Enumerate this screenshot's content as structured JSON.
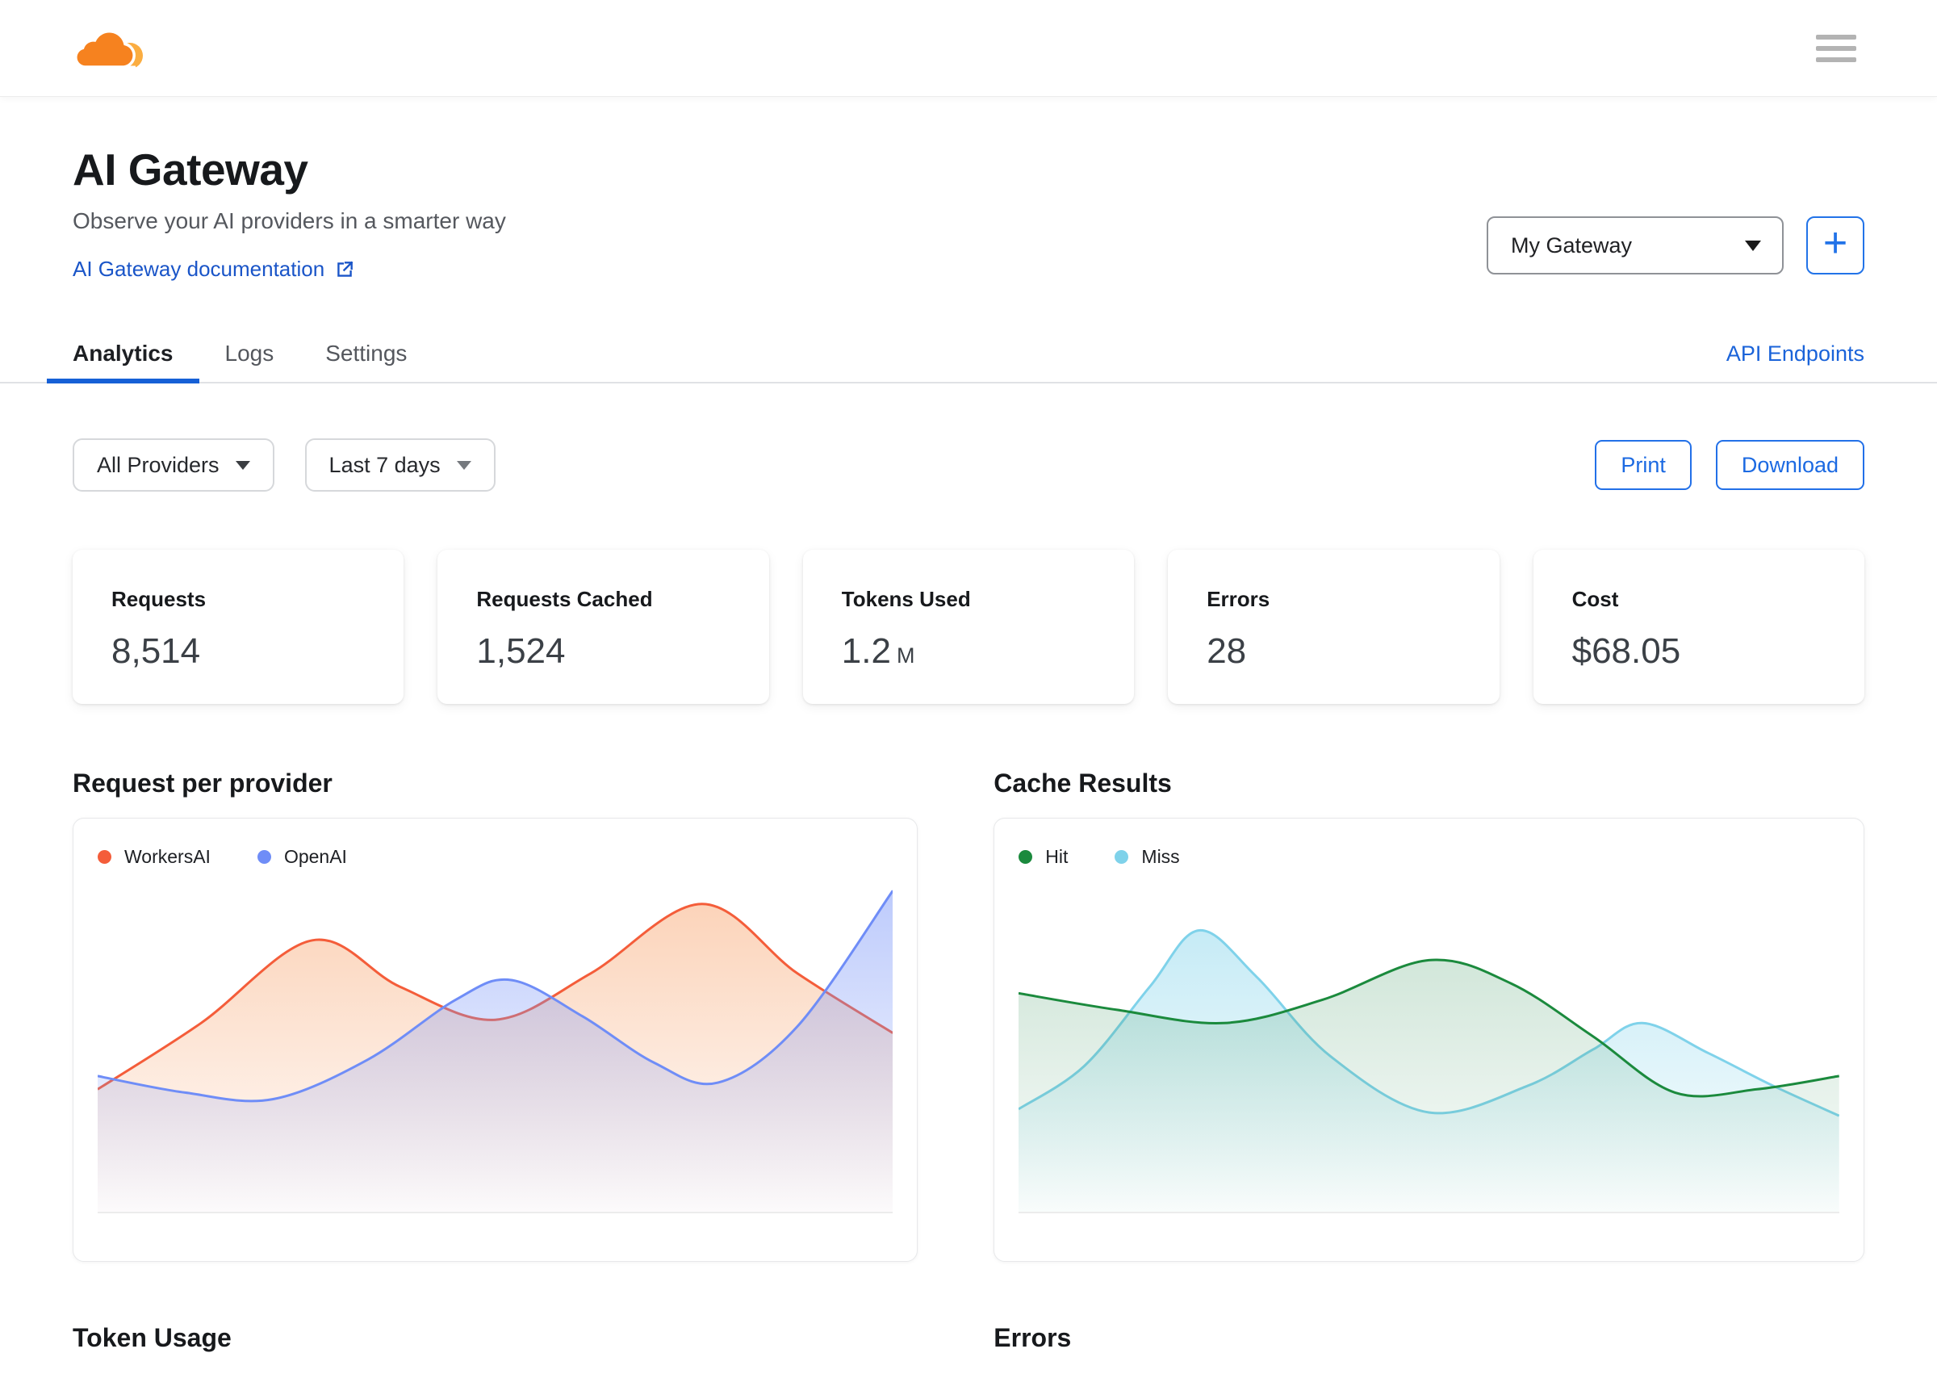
{
  "page": {
    "title": "AI Gateway",
    "subtitle": "Observe your AI providers in a smarter way",
    "doc_link": "AI Gateway documentation"
  },
  "gateway": {
    "selected": "My Gateway"
  },
  "icons": {
    "plus": "+"
  },
  "tabs": {
    "items": [
      "Analytics",
      "Logs",
      "Settings"
    ],
    "active": "Analytics",
    "api_link": "API Endpoints"
  },
  "filters": {
    "providers": "All Providers",
    "range": "Last 7 days"
  },
  "actions": {
    "print": "Print",
    "download": "Download"
  },
  "stats": [
    {
      "label": "Requests",
      "value": "8,514",
      "suffix": ""
    },
    {
      "label": "Requests Cached",
      "value": "1,524",
      "suffix": ""
    },
    {
      "label": "Tokens Used",
      "value": "1.2",
      "suffix": "M"
    },
    {
      "label": "Errors",
      "value": "28",
      "suffix": ""
    },
    {
      "label": "Cost",
      "value": "$68.05",
      "suffix": ""
    }
  ],
  "sections": {
    "chart1_title": "Request per provider",
    "chart2_title": "Cache Results",
    "bottom1_title": "Token Usage",
    "bottom2_title": "Errors"
  },
  "colors": {
    "brand_orange": "#F6821F",
    "brand_orange_light": "#FBAD41",
    "link_blue": "#1a55c8",
    "action_blue": "#1c6ae2",
    "tab_underline": "#1660d6"
  },
  "chart_data": [
    {
      "type": "area",
      "title": "Request per provider",
      "xlabel": "",
      "ylabel": "",
      "axes_visible": false,
      "legend_position": "top-left",
      "ylim": [
        0,
        100
      ],
      "x_range": [
        0,
        100
      ],
      "series": [
        {
          "name": "WorkersAI",
          "color": "#f45d3a",
          "fill": "#f6904e",
          "fill_opacity_top": 0.42,
          "z": 0,
          "points": [
            [
              0,
              37
            ],
            [
              13,
              57
            ],
            [
              27,
              82
            ],
            [
              38,
              68
            ],
            [
              50,
              58
            ],
            [
              62,
              72
            ],
            [
              76,
              93
            ],
            [
              88,
              72
            ],
            [
              100,
              54
            ]
          ]
        },
        {
          "name": "OpenAI",
          "color": "#6f8df7",
          "fill": "#7894f8",
          "fill_opacity_top": 0.5,
          "z": 1,
          "points": [
            [
              0,
              41
            ],
            [
              11,
              36
            ],
            [
              22,
              34
            ],
            [
              34,
              46
            ],
            [
              45,
              64
            ],
            [
              52,
              70
            ],
            [
              61,
              59
            ],
            [
              70,
              45
            ],
            [
              78,
              39
            ],
            [
              88,
              56
            ],
            [
              100,
              97
            ]
          ]
        }
      ]
    },
    {
      "type": "area",
      "title": "Cache Results",
      "xlabel": "",
      "ylabel": "",
      "axes_visible": false,
      "legend_position": "top-left",
      "ylim": [
        0,
        100
      ],
      "x_range": [
        0,
        100
      ],
      "series": [
        {
          "name": "Hit",
          "color": "#1b8a3d",
          "fill": "#3c965f",
          "fill_opacity_top": 0.3,
          "z": 1,
          "points": [
            [
              0,
              66
            ],
            [
              12,
              61
            ],
            [
              25,
              57
            ],
            [
              37,
              64
            ],
            [
              50,
              76
            ],
            [
              60,
              69
            ],
            [
              70,
              53
            ],
            [
              80,
              36
            ],
            [
              90,
              37
            ],
            [
              100,
              41
            ]
          ]
        },
        {
          "name": "Miss",
          "color": "#7fd2ea",
          "fill": "#7fd2ea",
          "fill_opacity_top": 0.52,
          "z": 0,
          "points": [
            [
              0,
              31
            ],
            [
              8,
              44
            ],
            [
              16,
              68
            ],
            [
              22,
              85
            ],
            [
              29,
              71
            ],
            [
              38,
              47
            ],
            [
              50,
              30
            ],
            [
              62,
              38
            ],
            [
              70,
              49
            ],
            [
              76,
              57
            ],
            [
              84,
              48
            ],
            [
              92,
              38
            ],
            [
              100,
              29
            ]
          ]
        }
      ]
    }
  ]
}
